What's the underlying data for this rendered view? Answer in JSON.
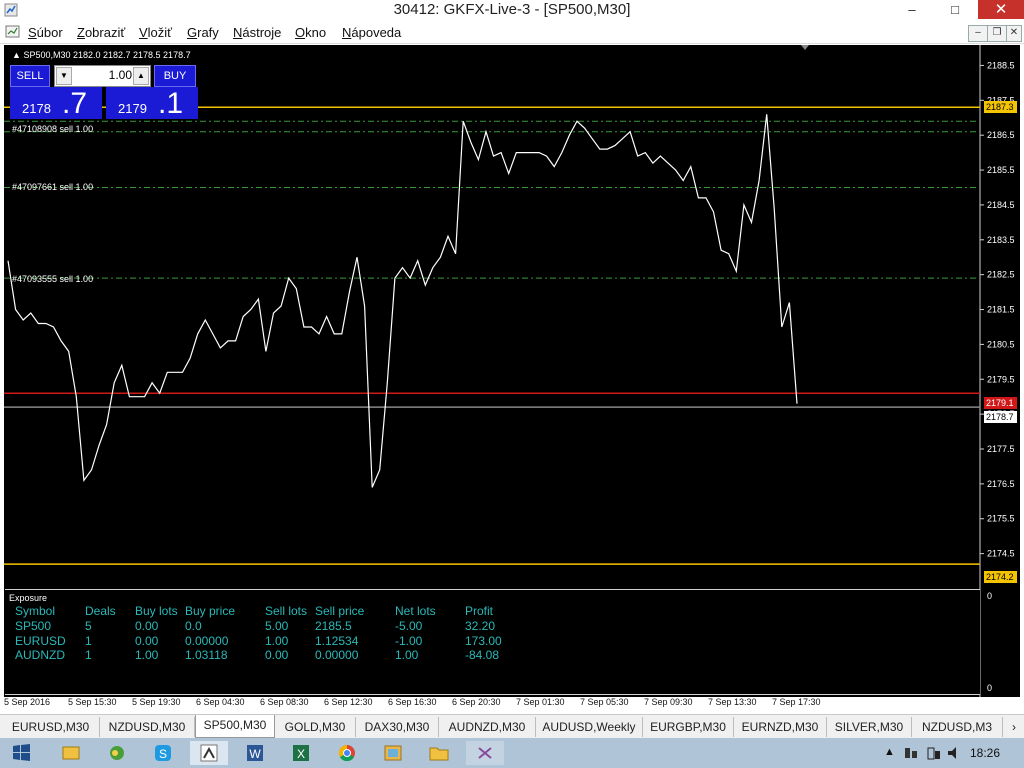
{
  "window": {
    "title": "30412: GKFX-Live-3 - [SP500,M30]",
    "buttons": [
      "–",
      "□",
      "✕"
    ]
  },
  "menu": {
    "items": [
      {
        "label": "Súbor",
        "hotkey": "S",
        "rest": "úbor"
      },
      {
        "label": "Zobraziť",
        "hotkey": "Z",
        "rest": "obraziť"
      },
      {
        "label": "Vložiť",
        "hotkey": "V",
        "rest": "ložiť"
      },
      {
        "label": "Grafy",
        "hotkey": "G",
        "rest": "rafy"
      },
      {
        "label": "Nástroje",
        "hotkey": "N",
        "rest": "ástroje"
      },
      {
        "label": "Okno",
        "hotkey": "O",
        "rest": "kno"
      },
      {
        "label": "Nápoveda",
        "hotkey": "N",
        "rest": "ápoveda"
      }
    ],
    "mdi_buttons": [
      "–",
      "❐",
      "✕"
    ]
  },
  "chart": {
    "header": "SP500,M30  2182.0 2182.7 2178.5 2178.7",
    "header_arrow": "▲",
    "trade": {
      "sell_label": "SELL",
      "buy_label": "BUY",
      "lot": "1.00",
      "sell_price_small": "2178",
      "sell_price_big": ".7",
      "buy_price_small": "2179",
      "buy_price_big": ".1"
    },
    "orders": [
      {
        "label": "#47108908 sell 1.00",
        "price": 2186.6
      },
      {
        "label": "#47097661 sell 1.00",
        "price": 2185.0
      },
      {
        "label": "#47093555 sell 1.00",
        "price": 2182.4
      }
    ],
    "price_tags": {
      "upper": "2187.3",
      "ask": "2179.1",
      "bid": "2178.7",
      "lower": "2174.2"
    },
    "price_axis_labels": [
      "2188.5",
      "2187.5",
      "2186.5",
      "2185.5",
      "2184.5",
      "2183.5",
      "2182.5",
      "2181.5",
      "2180.5",
      "2179.5",
      "2178.5",
      "2177.5",
      "2176.5",
      "2175.5",
      "2174.5"
    ],
    "time_labels": [
      "5 Sep 2016",
      "5 Sep 15:30",
      "5 Sep 19:30",
      "6 Sep 04:30",
      "6 Sep 08:30",
      "6 Sep 12:30",
      "6 Sep 16:30",
      "6 Sep 20:30",
      "7 Sep 01:30",
      "7 Sep 05:30",
      "7 Sep 09:30",
      "7 Sep 13:30",
      "7 Sep 17:30"
    ],
    "colors": {
      "background": "#000000",
      "line": "#ffffff",
      "level_yellow": "#f5c400",
      "ask_red": "#d01818",
      "order_green": "#3a9a3a",
      "panel_blue": "#1b1bd6",
      "exposure_text": "#2cb8b8"
    }
  },
  "chart_data": {
    "type": "line",
    "series": [
      {
        "values": [
          2182.9,
          2181.5,
          2181.2,
          2181.4,
          2181.1,
          2181.1,
          2181.0,
          2180.6,
          2180.3,
          2179.0,
          2176.6,
          2176.9,
          2177.6,
          2178.2,
          2179.4,
          2179.9,
          2179.0,
          2179.0,
          2179.0,
          2179.4,
          2179.1,
          2179.7,
          2179.7,
          2179.7,
          2180.1,
          2180.8,
          2181.2,
          2180.8,
          2180.4,
          2180.6,
          2180.6,
          2181.3,
          2181.5,
          2181.8,
          2180.3,
          2181.4,
          2181.6,
          2182.4,
          2182.1,
          2181.0,
          2181.0,
          2180.8,
          2181.3,
          2180.8,
          2180.8,
          2182.0,
          2183.0,
          2181.6,
          2176.4,
          2176.9,
          2179.4,
          2182.4,
          2182.7,
          2182.4,
          2182.9,
          2182.2,
          2182.7,
          2183.0,
          2183.6,
          2183.1,
          2186.9,
          2186.3,
          2185.8,
          2186.6,
          2185.9,
          2186.0,
          2185.4,
          2186.0,
          2186.0,
          2186.0,
          2186.0,
          2185.9,
          2185.6,
          2186.0,
          2186.5,
          2186.9,
          2186.7,
          2186.4,
          2186.1,
          2186.1,
          2186.2,
          2186.4,
          2186.6,
          2185.9,
          2186.0,
          2185.7,
          2185.9,
          2185.7,
          2185.5,
          2185.2,
          2185.6,
          2184.7,
          2184.7,
          2184.3,
          2183.2,
          2183.1,
          2182.6,
          2184.5,
          2184.0,
          2185.2,
          2187.1,
          2184.4,
          2181.0,
          2181.7,
          2178.8
        ]
      }
    ],
    "xlabel": "",
    "ylabel": "",
    "ylim": [
      2173.6,
      2189.0
    ],
    "time_labels": [
      "5 Sep 2016",
      "5 Sep 15:30",
      "5 Sep 19:30",
      "6 Sep 04:30",
      "6 Sep 08:30",
      "6 Sep 12:30",
      "6 Sep 16:30",
      "6 Sep 20:30",
      "7 Sep 01:30",
      "7 Sep 05:30",
      "7 Sep 09:30",
      "7 Sep 13:30",
      "7 Sep 17:30"
    ],
    "grid": false,
    "levels": [
      {
        "price": 2187.3,
        "style": "solid",
        "color": "#f5c400"
      },
      {
        "price": 2186.9,
        "style": "dashed",
        "color": "#3a9a3a"
      },
      {
        "price": 2186.6,
        "style": "dashed",
        "color": "#3a9a3a"
      },
      {
        "price": 2185.0,
        "style": "dashed",
        "color": "#3a9a3a"
      },
      {
        "price": 2182.4,
        "style": "dashed",
        "color": "#3a9a3a"
      },
      {
        "price": 2179.1,
        "style": "solid",
        "color": "#d01818"
      },
      {
        "price": 2178.7,
        "style": "solid",
        "color": "#888888"
      },
      {
        "price": 2174.2,
        "style": "solid",
        "color": "#f5c400"
      }
    ]
  },
  "exposure": {
    "title": "Exposure",
    "columns": [
      "Symbol",
      "Deals",
      "Buy lots",
      "Buy price",
      "Sell lots",
      "Sell price",
      "Net lots",
      "Profit"
    ],
    "rows": [
      [
        "SP500",
        "5",
        "0.00",
        "0.0",
        "5.00",
        "2185.5",
        "-5.00",
        "32.20"
      ],
      [
        "EURUSD",
        "1",
        "0.00",
        "0.00000",
        "1.00",
        "1.12534",
        "-1.00",
        "173.00"
      ],
      [
        "AUDNZD",
        "1",
        "1.00",
        "1.03118",
        "0.00",
        "0.00000",
        "1.00",
        "-84.08"
      ]
    ],
    "scale_top": "0",
    "scale_bottom": "0"
  },
  "tabs": [
    {
      "label": "EURUSD,M30",
      "active": false
    },
    {
      "label": "NZDUSD,M30",
      "active": false
    },
    {
      "label": "SP500,M30",
      "active": true
    },
    {
      "label": "GOLD,M30",
      "active": false
    },
    {
      "label": "DAX30,M30",
      "active": false
    },
    {
      "label": "AUDNZD,M30",
      "active": false
    },
    {
      "label": "AUDUSD,Weekly",
      "active": false
    },
    {
      "label": "EURGBP,M30",
      "active": false
    },
    {
      "label": "EURNZD,M30",
      "active": false
    },
    {
      "label": "SILVER,M30",
      "active": false
    },
    {
      "label": "NZDUSD,M3",
      "active": false
    }
  ],
  "taskbar": {
    "apps": [
      "start-icon",
      "explorer-icon",
      "hyperlink-icon",
      "skype-icon",
      "metatrader-icon",
      "word-icon",
      "excel-icon",
      "chrome-icon",
      "picture-icon",
      "folder-icon",
      "app-icon"
    ],
    "clock": "18:26"
  }
}
